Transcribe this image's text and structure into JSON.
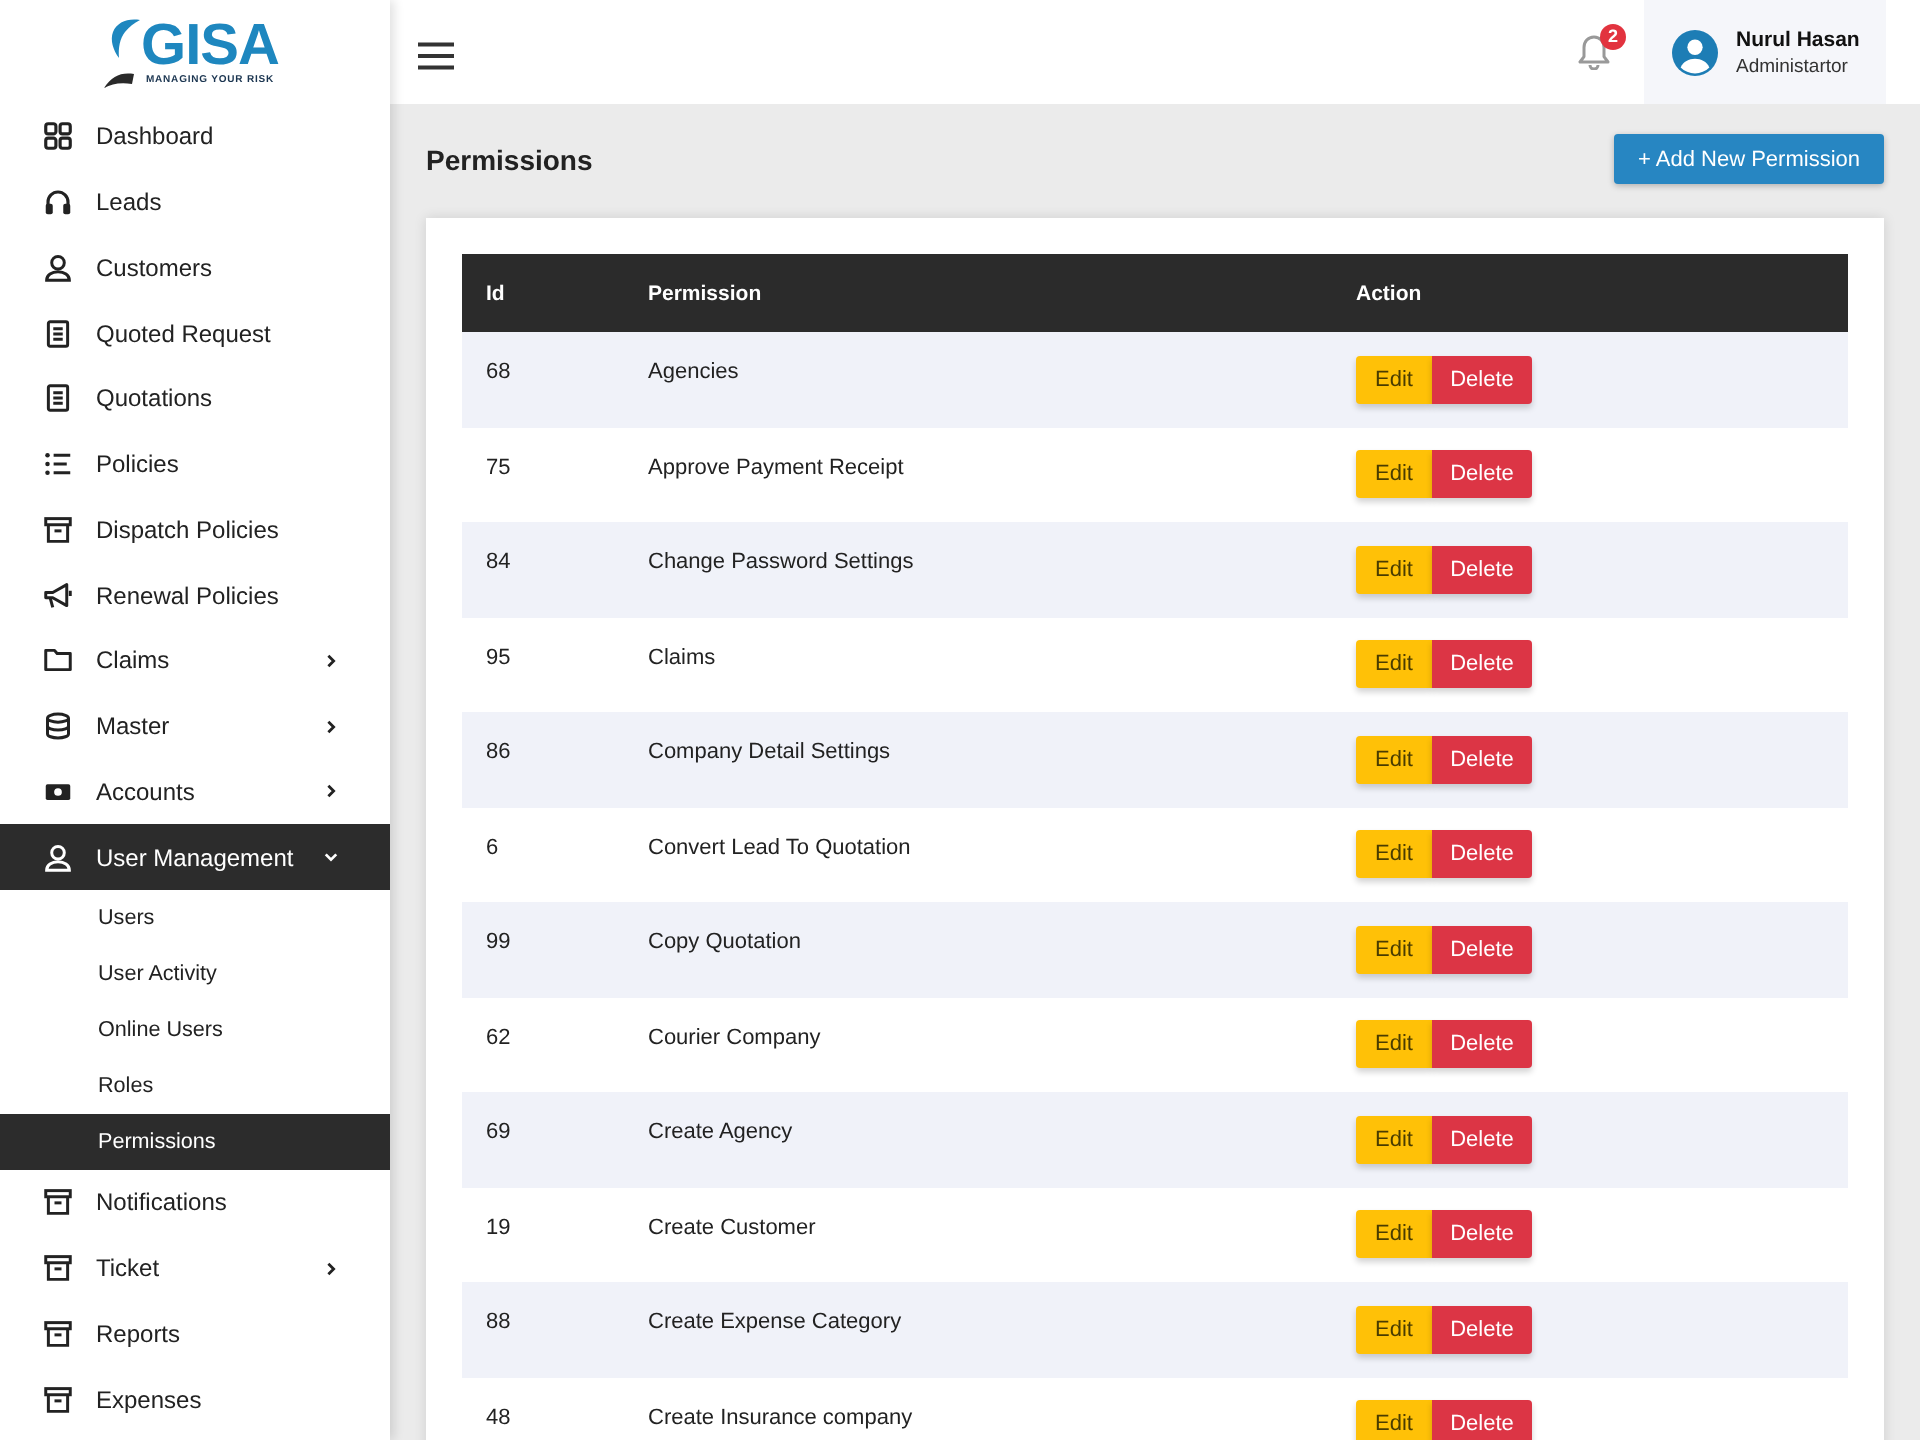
{
  "logo": {
    "name": "GISA",
    "tagline": "MANAGING YOUR RISK"
  },
  "nav": [
    {
      "label": "Dashboard",
      "kind": "link",
      "selected": false
    },
    {
      "label": "Leads",
      "kind": "link",
      "selected": false
    },
    {
      "label": "Customers",
      "kind": "link",
      "selected": false
    },
    {
      "label": "Quoted Request",
      "kind": "link",
      "selected": false
    },
    {
      "label": "Quotations",
      "kind": "link",
      "selected": false
    },
    {
      "label": "Policies",
      "kind": "link",
      "selected": false
    },
    {
      "label": "Dispatch Policies",
      "kind": "link",
      "selected": false
    },
    {
      "label": "Renewal Policies",
      "kind": "link",
      "selected": false
    },
    {
      "label": "Claims",
      "kind": "group",
      "expanded": false,
      "selected": false
    },
    {
      "label": "Master",
      "kind": "group",
      "expanded": false,
      "selected": false
    },
    {
      "label": "Accounts",
      "kind": "group",
      "expanded": false,
      "selected": false
    },
    {
      "label": "User Management",
      "kind": "group",
      "expanded": true,
      "selected": true,
      "children": [
        {
          "label": "Users",
          "selected": false
        },
        {
          "label": "User Activity",
          "selected": false
        },
        {
          "label": "Online Users",
          "selected": false
        },
        {
          "label": "Roles",
          "selected": false
        },
        {
          "label": "Permissions",
          "selected": true
        }
      ]
    },
    {
      "label": "Notifications",
      "kind": "link",
      "selected": false
    },
    {
      "label": "Ticket",
      "kind": "group",
      "expanded": false,
      "selected": false
    },
    {
      "label": "Reports",
      "kind": "link",
      "selected": false
    },
    {
      "label": "Expenses",
      "kind": "link",
      "selected": false
    }
  ],
  "topbar": {
    "notifications": {
      "count": "2"
    },
    "user": {
      "name": "Nurul Hasan",
      "role": "Administartor"
    }
  },
  "page": {
    "title": "Permissions",
    "add_button": "+ Add New Permission"
  },
  "table": {
    "columns": [
      "Id",
      "Permission",
      "Action"
    ],
    "rows": [
      {
        "id": "68",
        "permission": "Agencies",
        "edit": "Edit",
        "delete": "Delete"
      },
      {
        "id": "75",
        "permission": "Approve Payment Receipt",
        "edit": "Edit",
        "delete": "Delete"
      },
      {
        "id": "84",
        "permission": "Change Password Settings",
        "edit": "Edit",
        "delete": "Delete"
      },
      {
        "id": "95",
        "permission": "Claims",
        "edit": "Edit",
        "delete": "Delete"
      },
      {
        "id": "86",
        "permission": "Company Detail Settings",
        "edit": "Edit",
        "delete": "Delete"
      },
      {
        "id": "6",
        "permission": "Convert Lead To Quotation",
        "edit": "Edit",
        "delete": "Delete"
      },
      {
        "id": "99",
        "permission": "Copy Quotation",
        "edit": "Edit",
        "delete": "Delete"
      },
      {
        "id": "62",
        "permission": "Courier Company",
        "edit": "Edit",
        "delete": "Delete"
      },
      {
        "id": "69",
        "permission": "Create Agency",
        "edit": "Edit",
        "delete": "Delete"
      },
      {
        "id": "19",
        "permission": "Create Customer",
        "edit": "Edit",
        "delete": "Delete"
      },
      {
        "id": "88",
        "permission": "Create Expense Category",
        "edit": "Edit",
        "delete": "Delete"
      },
      {
        "id": "48",
        "permission": "Create Insurance company",
        "edit": "Edit",
        "delete": "Delete"
      }
    ]
  }
}
